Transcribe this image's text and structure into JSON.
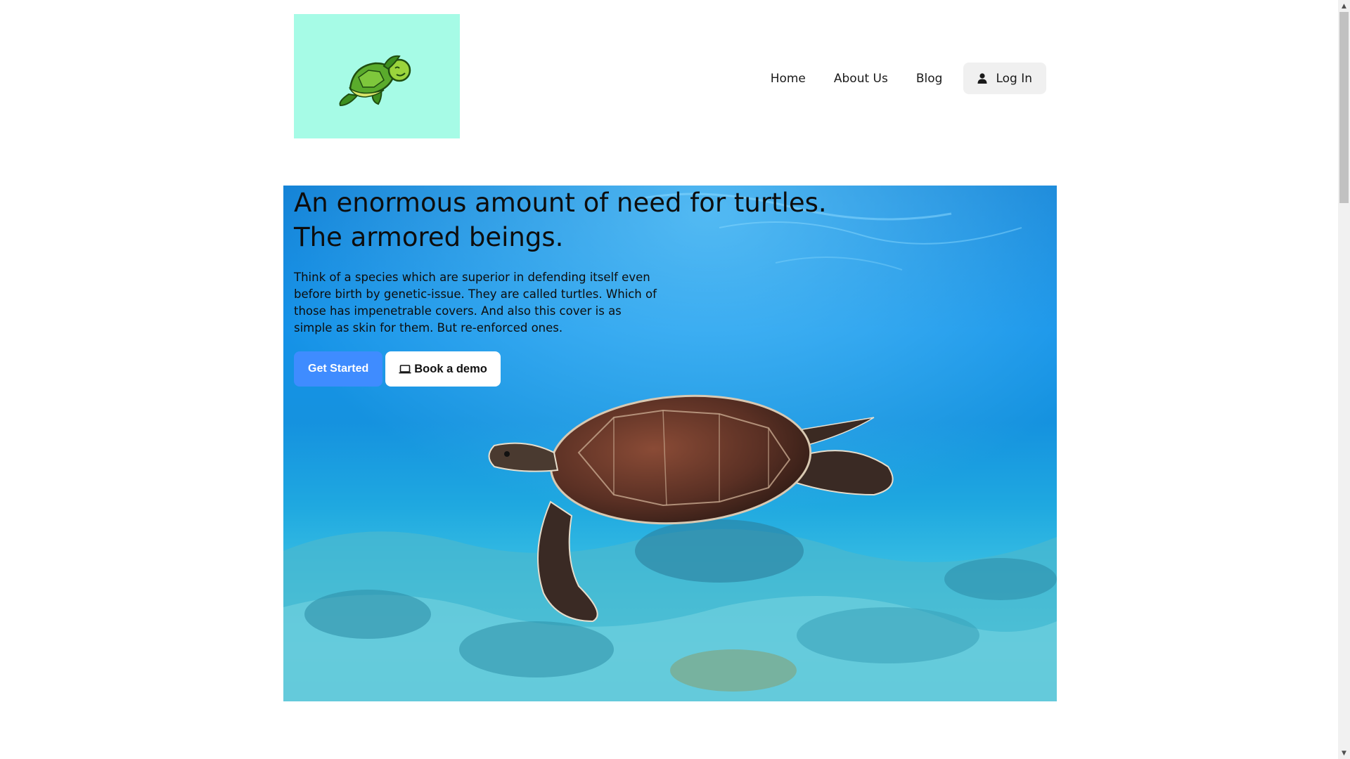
{
  "header": {
    "logo_icon": "turtle-logo-icon",
    "logo_bg": "#a6fbe6"
  },
  "nav": {
    "items": [
      {
        "label": "Home"
      },
      {
        "label": "About Us"
      },
      {
        "label": "Blog"
      }
    ],
    "login_label": "Log In",
    "login_icon": "user-icon"
  },
  "hero": {
    "title_line1": "An enormous amount of need for turtles.",
    "title_line2": "The armored beings.",
    "text": "Think of a species which are superior in defending itself even before birth by genetic-issue. They are called turtles. Which of those has impenetrable covers. And also this cover is as simple as skin for them. But re-enforced ones.",
    "primary_button": "Get Started",
    "secondary_button": "Book a demo",
    "secondary_icon": "laptop-icon",
    "image": "sea-turtle-underwater-photo"
  },
  "colors": {
    "accent": "#3f8cff",
    "login_bg": "#f0f0f0"
  }
}
